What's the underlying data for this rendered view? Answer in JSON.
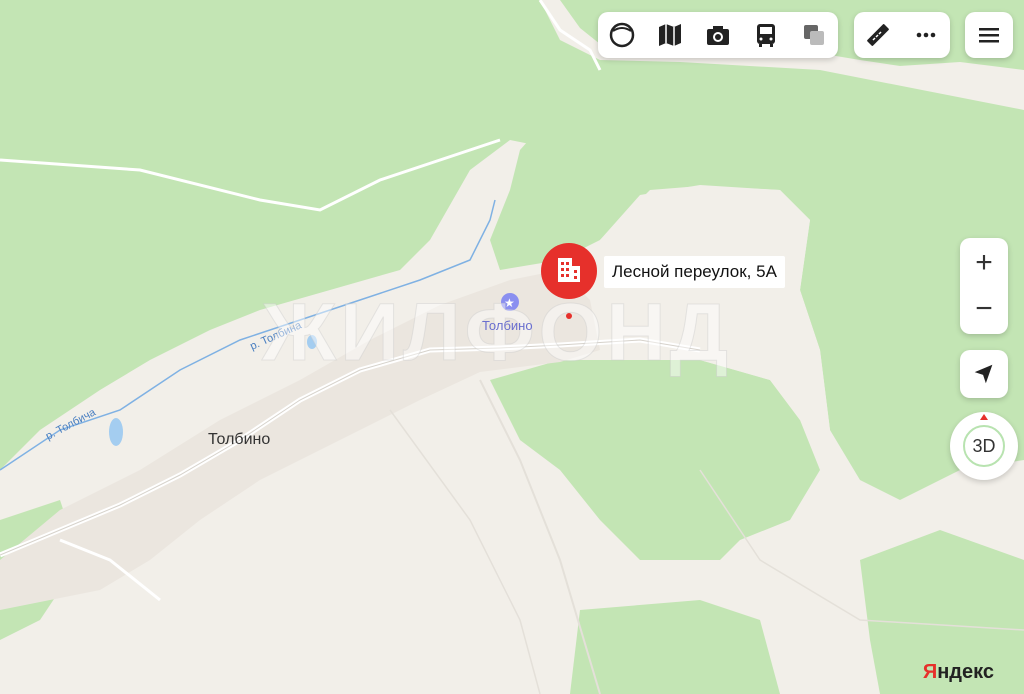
{
  "map": {
    "marker_label": "Лесной переулок, 5А",
    "town_label": "Толбино",
    "poi_label": "Толбино",
    "river_label_1": "р. Толбина",
    "river_label_2": "р. Толбича",
    "watermark": "ЖИЛФОНД",
    "brand_first": "Я",
    "brand_rest": "ндекс",
    "colors": {
      "forest": "#c3e5b4",
      "land": "#f2efe9",
      "settlement": "#ebe6df",
      "marker": "#e6302b",
      "water": "#a4cdf0"
    }
  },
  "toolbar": {
    "layers": [
      "panorama-icon",
      "map-split-icon",
      "camera-icon",
      "bus-icon",
      "layers-icon"
    ],
    "tools": [
      "ruler-icon",
      "more-icon"
    ],
    "menu": "menu-icon"
  },
  "controls": {
    "zoom_in": "+",
    "zoom_out": "−",
    "mode_3d": "3D"
  }
}
